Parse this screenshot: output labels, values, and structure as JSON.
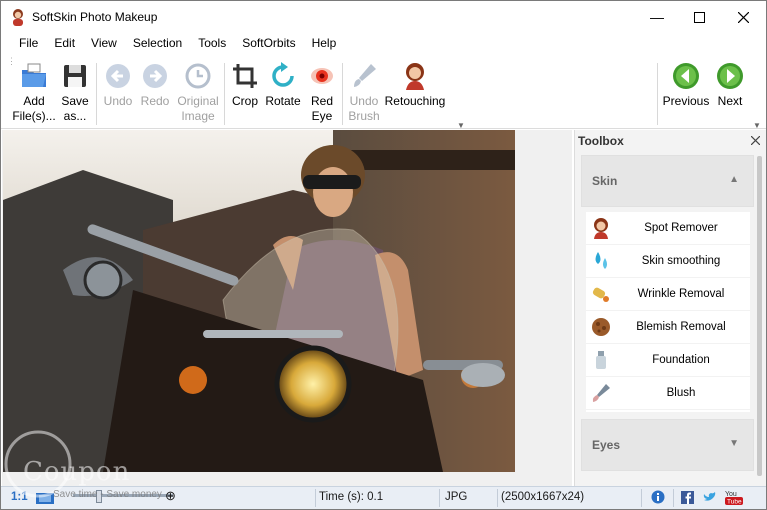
{
  "window": {
    "title": "SoftSkin Photo Makeup",
    "controls": [
      "minimize",
      "maximize",
      "close"
    ]
  },
  "menu": [
    "File",
    "Edit",
    "View",
    "Selection",
    "Tools",
    "SoftOrbits",
    "Help"
  ],
  "toolbar": {
    "add_files": "Add\nFile(s)...",
    "save_as": "Save\nas...",
    "undo": "Undo",
    "redo": "Redo",
    "original_image": "Original\nImage",
    "crop": "Crop",
    "rotate": "Rotate",
    "red_eye": "Red\nEye",
    "undo_brush": "Undo\nBrush",
    "retouching": "Retouching",
    "previous": "Previous",
    "next": "Next"
  },
  "toolbox": {
    "title": "Toolbox",
    "sections": [
      {
        "name": "Skin",
        "expanded": true,
        "tools": [
          "Spot Remover",
          "Skin smoothing",
          "Wrinkle Removal",
          "Blemish Removal",
          "Foundation",
          "Blush"
        ]
      },
      {
        "name": "Eyes",
        "expanded": false
      }
    ]
  },
  "status": {
    "zoom_label": "1:1",
    "time": "Time (s): 0.1",
    "format": "JPG",
    "dimensions": "(2500x1667x24)"
  },
  "watermark": {
    "brand": "Coupon",
    "tagline": "Save time - Save money"
  },
  "colors": {
    "accent_blue": "#2a6fc4",
    "nav_green": "#3f9a2b",
    "statusbar_bg": "#e9eef5",
    "toolbox_bg": "#f3f3f3"
  }
}
